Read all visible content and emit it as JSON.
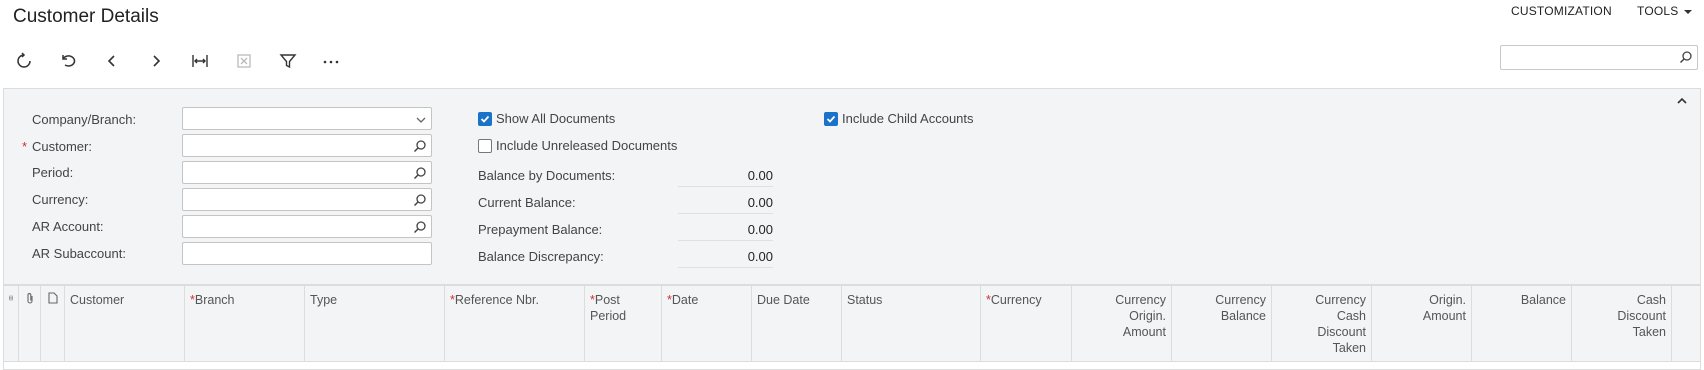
{
  "header": {
    "title": "Customer Details",
    "menu": [
      {
        "label": "CUSTOMIZATION",
        "has_caret": false
      },
      {
        "label": "TOOLS",
        "has_caret": true
      }
    ]
  },
  "toolbar": {
    "buttons": [
      "refresh-icon",
      "undo-icon",
      "previous-icon",
      "next-icon",
      "fit-width-icon",
      "export-excel-icon",
      "filter-icon",
      "more-icon"
    ],
    "search": {
      "value": "",
      "placeholder": ""
    }
  },
  "form": {
    "fields": [
      {
        "label": "Company/Branch:",
        "required": false,
        "value": "",
        "icon": "dropdown-icon"
      },
      {
        "label": "Customer:",
        "required": true,
        "value": "",
        "icon": "search-icon"
      },
      {
        "label": "Period:",
        "required": false,
        "value": "",
        "icon": "search-icon"
      },
      {
        "label": "Currency:",
        "required": false,
        "value": "",
        "icon": "search-icon"
      },
      {
        "label": "AR Account:",
        "required": false,
        "value": "",
        "icon": "search-icon"
      },
      {
        "label": "AR Subaccount:",
        "required": false,
        "value": "",
        "icon": ""
      }
    ],
    "checkboxes": {
      "show_all_documents": {
        "label": "Show All Documents",
        "checked": true
      },
      "include_unreleased": {
        "label": "Include Unreleased Documents",
        "checked": false
      },
      "include_child_accounts": {
        "label": "Include Child Accounts",
        "checked": true
      }
    },
    "balances": [
      {
        "label": "Balance by Documents:",
        "value": "0.00"
      },
      {
        "label": "Current Balance:",
        "value": "0.00"
      },
      {
        "label": "Prepayment Balance:",
        "value": "0.00"
      },
      {
        "label": "Balance Discrepancy:",
        "value": "0.00"
      }
    ]
  },
  "grid": {
    "columns": [
      {
        "label": "Customer",
        "required": false
      },
      {
        "label": "Branch",
        "required": true
      },
      {
        "label": "Type",
        "required": false
      },
      {
        "label": "Reference Nbr.",
        "required": true
      },
      {
        "label": "Post Period",
        "required": true
      },
      {
        "label": "Date",
        "required": true
      },
      {
        "label": "Due Date",
        "required": false
      },
      {
        "label": "Status",
        "required": false
      },
      {
        "label": "Currency",
        "required": true
      },
      {
        "label": "Currency Origin. Amount",
        "required": false
      },
      {
        "label": "Currency Balance",
        "required": false
      },
      {
        "label": "Currency Cash Discount Taken",
        "required": false
      },
      {
        "label": "Origin. Amount",
        "required": false
      },
      {
        "label": "Balance",
        "required": false
      },
      {
        "label": "Cash Discount Taken",
        "required": false
      }
    ]
  },
  "colors": {
    "accent": "#1a73c9",
    "required": "#d32f2f",
    "panel": "#f3f4f6"
  }
}
